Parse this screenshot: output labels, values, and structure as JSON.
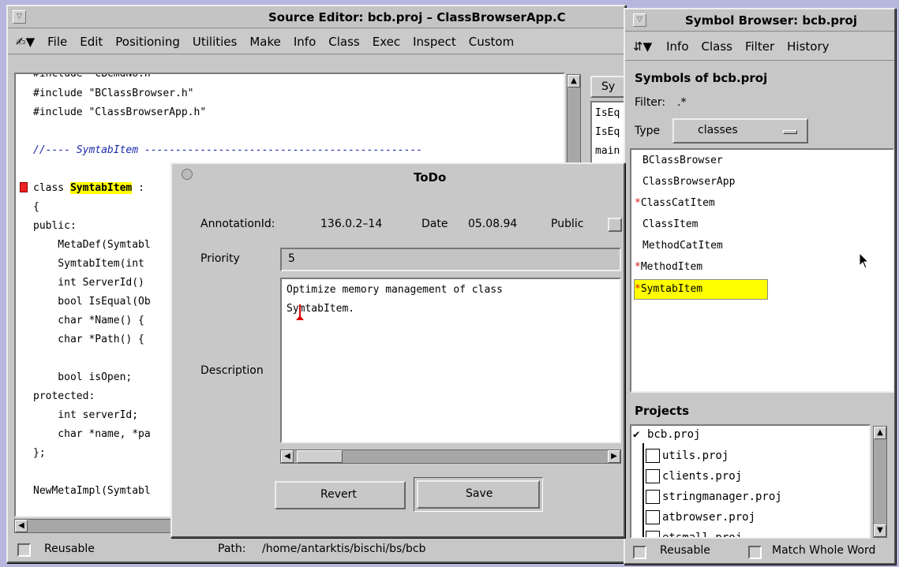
{
  "source_editor": {
    "title": "Source Editor: bcb.proj – ClassBrowserApp.C",
    "menu": [
      "File",
      "Edit",
      "Positioning",
      "Utilities",
      "Make",
      "Info",
      "Class",
      "Exec",
      "Inspect",
      "Custom"
    ],
    "code_lines": [
      "#include \"CBCmdNo.h\"",
      "#include \"BClassBrowser.h\"",
      "#include \"ClassBrowserApp.h\"",
      "",
      "//---- SymtabItem ---------------------------------------------",
      "",
      "class ",
      "{",
      "public:",
      "    MetaDef(Symtabl",
      "    SymtabItem(int",
      "    int ServerId()",
      "    bool IsEqual(Ob",
      "    char *Name() {",
      "    char *Path() {",
      "",
      "    bool isOpen;",
      "protected:",
      "    int serverId;",
      "    char *name, *pa",
      "};",
      "",
      "NewMetaImpl(Symtabl"
    ],
    "highlighted_class": "SymtabItem",
    "class_suffix": " :",
    "side_button": "Sy",
    "side_list": [
      "IsEq",
      "IsEq",
      "main"
    ],
    "reusable_label": "Reusable",
    "path_label": "Path:",
    "path_value": "/home/antarktis/bischi/bs/bcb"
  },
  "todo_dialog": {
    "title": "ToDo",
    "annotation_label": "AnnotationId:",
    "annotation_value": "136.0.2–14",
    "date_label": "Date",
    "date_value": "05.08.94",
    "public_label": "Public",
    "priority_label": "Priority",
    "priority_value": "5",
    "description_label": "Description",
    "description_line1": "Optimize memory management of class",
    "description_line2": "SymtabItem.",
    "revert_label": "Revert",
    "save_label": "Save"
  },
  "symbol_browser": {
    "title": "Symbol Browser: bcb.proj",
    "menu": [
      "Info",
      "Class",
      "Filter",
      "History"
    ],
    "heading": "Symbols of bcb.proj",
    "filter_label": "Filter:",
    "filter_value": ".*",
    "type_label": "Type",
    "type_value": "classes",
    "symbols": [
      {
        "name": "BClassBrowser",
        "starred": false
      },
      {
        "name": "ClassBrowserApp",
        "starred": false
      },
      {
        "name": "ClassCatItem",
        "starred": true
      },
      {
        "name": "ClassItem",
        "starred": false
      },
      {
        "name": "MethodCatItem",
        "starred": false
      },
      {
        "name": "MethodItem",
        "starred": true
      },
      {
        "name": "SymtabItem",
        "starred": true
      }
    ],
    "star": "*",
    "projects_heading": "Projects",
    "projects": [
      "bcb.proj",
      "utils.proj",
      "clients.proj",
      "stringmanager.proj",
      "atbrowser.proj",
      "etsmall.proj"
    ],
    "reusable_label": "Reusable",
    "match_label": "Match Whole Word"
  },
  "colors": {
    "desktop": "#b6b6de",
    "highlight": "#ffff00",
    "star": "#dd1111"
  }
}
